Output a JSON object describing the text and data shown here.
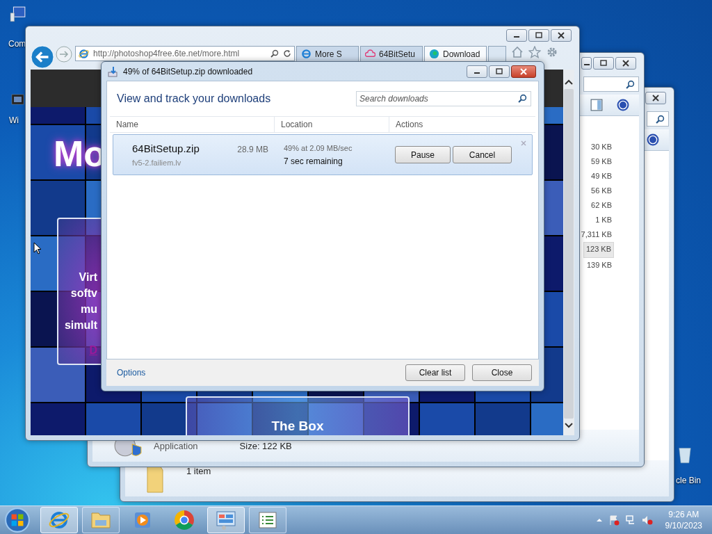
{
  "desktop_icons": [
    {
      "label": "Com",
      "kind": "computer"
    },
    {
      "label": "Wi",
      "kind": "media"
    },
    {
      "label": "cle Bin",
      "kind": "bin"
    }
  ],
  "explorer_back": {
    "status": "1 item"
  },
  "explorer_front": {
    "sizes": [
      {
        "text": "30 KB",
        "selected": false
      },
      {
        "text": "59 KB",
        "selected": false
      },
      {
        "text": "49 KB",
        "selected": false
      },
      {
        "text": "56 KB",
        "selected": false
      },
      {
        "text": "62 KB",
        "selected": false
      },
      {
        "text": "1 KB",
        "selected": false
      },
      {
        "text": "7,311 KB",
        "selected": false
      },
      {
        "text": "123 KB",
        "selected": true
      },
      {
        "text": "139 KB",
        "selected": false
      }
    ],
    "details": {
      "type": "Application",
      "size": "Size: 122 KB"
    }
  },
  "browser": {
    "address": "http://photoshop4free.6te.net/more.html",
    "tabs": [
      {
        "label": "More S",
        "kind": "ie",
        "selected": false
      },
      {
        "label": "64BitSetu",
        "kind": "cloud",
        "selected": false
      },
      {
        "label": "Download",
        "kind": "globe",
        "selected": true
      }
    ],
    "page": {
      "heading": "Mo",
      "promo_lines": [
        "Virt",
        "softv",
        "mu",
        "simult"
      ],
      "promo_link": "D",
      "box_title": "The Box"
    }
  },
  "downloads_dialog": {
    "title": "49% of 64BitSetup.zip downloaded",
    "heading": "View and track your downloads",
    "search": {
      "placeholder": "Search downloads"
    },
    "columns": [
      "Name",
      "Location",
      "Actions"
    ],
    "items": [
      {
        "name": "64BitSetup.zip",
        "source": "fv5-2.failiem.lv",
        "size": "28.9 MB",
        "progress": "49% at 2.09 MB/sec",
        "remaining": "7 sec remaining",
        "selected": true,
        "actions": [
          "Pause",
          "Cancel"
        ]
      }
    ],
    "options_link": "Options",
    "buttons": [
      "Clear list",
      "Close"
    ]
  },
  "taskbar": {
    "items": [
      {
        "kind": "ie",
        "running": true,
        "selected": true
      },
      {
        "kind": "folder",
        "running": true,
        "selected": false
      },
      {
        "kind": "media",
        "running": false,
        "selected": false
      },
      {
        "kind": "chrome",
        "running": false,
        "selected": false
      },
      {
        "kind": "panel",
        "running": true,
        "selected": true
      },
      {
        "kind": "list",
        "running": true,
        "selected": false
      }
    ],
    "time": "9:26 AM",
    "date": "9/10/2023"
  }
}
